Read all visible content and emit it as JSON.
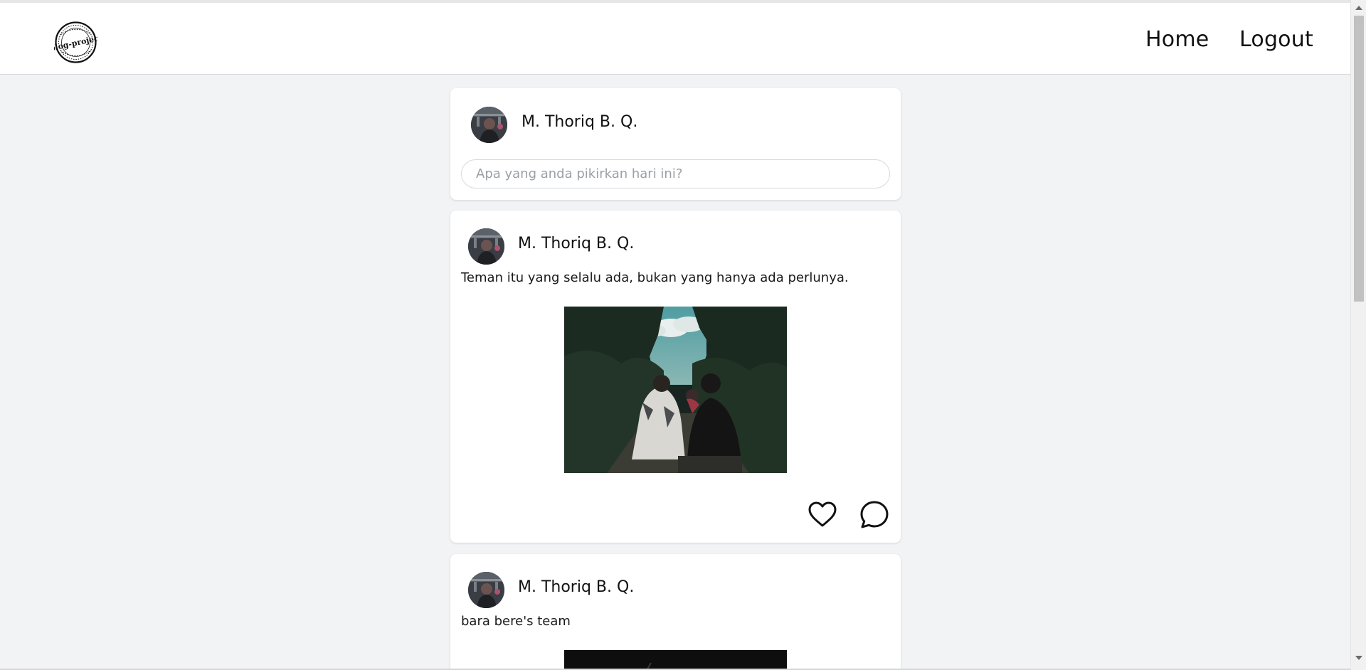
{
  "header": {
    "logo_text": "blog-project",
    "nav": {
      "home_label": "Home",
      "logout_label": "Logout"
    }
  },
  "composer": {
    "author": "M. Thoriq B. Q.",
    "placeholder": "Apa yang anda pikirkan hari ini?"
  },
  "posts": [
    {
      "author": "M. Thoriq B. Q.",
      "text": "Teman itu yang selalu ada, bukan yang hanya ada perlunya.",
      "actions": [
        "heart-icon",
        "comment-icon"
      ]
    },
    {
      "author": "M. Thoriq B. Q.",
      "text": "bara bere's team"
    }
  ],
  "colors": {
    "page_background": "#f2f3f5",
    "card_background": "#ffffff",
    "header_background": "#ffffff"
  }
}
